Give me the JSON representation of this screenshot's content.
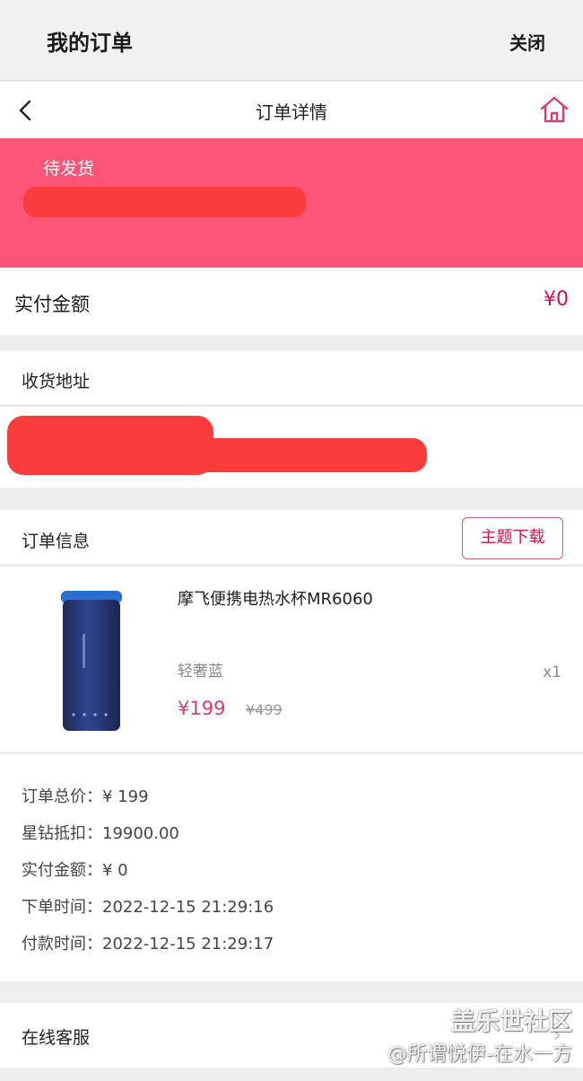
{
  "topbar": {
    "title": "我的订单",
    "close_label": "关闭"
  },
  "navbar": {
    "title": "订单详情",
    "back_icon": "chevron-left-icon",
    "home_icon": "home-icon"
  },
  "status": {
    "label": "待发货",
    "banner_color": "#fc5577"
  },
  "paid": {
    "label": "实付金额",
    "value": "¥0"
  },
  "address": {
    "title": "收货地址"
  },
  "order_info": {
    "title": "订单信息",
    "theme_button": "主题下载"
  },
  "product": {
    "name": "摩飞便携电热水杯MR6060",
    "spec": "轻奢蓝",
    "quantity": "x1",
    "price": "¥199",
    "original_price": "¥499"
  },
  "summary": {
    "rows": [
      {
        "key": "订单总价：",
        "value": "¥ 199"
      },
      {
        "key": "星钻抵扣：",
        "value": "19900.00"
      },
      {
        "key": "实付金额：",
        "value": "¥ 0"
      },
      {
        "key": "下单时间：",
        "value": "2022-12-15 21:29:16"
      },
      {
        "key": "付款时间：",
        "value": "2022-12-15 21:29:17"
      }
    ]
  },
  "service": {
    "label": "在线客服"
  },
  "watermark": {
    "line1": "盖乐世社区",
    "line2": "@所谓悦伊-在水一方"
  },
  "colors": {
    "accent": "#c8134f",
    "price": "#d63b73",
    "redaction": "#fb3c3c"
  }
}
